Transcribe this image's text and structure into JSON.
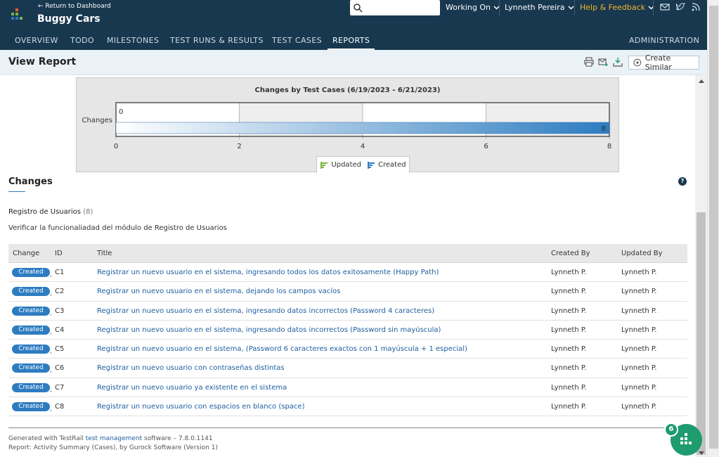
{
  "header": {
    "return_link": "← Return to Dashboard",
    "project_name": "Buggy Cars",
    "search_placeholder": "",
    "working_on": "Working On",
    "user": "Lynneth Pereira",
    "help": "Help & Feedback"
  },
  "nav": {
    "items": [
      "OVERVIEW",
      "TODO",
      "MILESTONES",
      "TEST RUNS & RESULTS",
      "TEST CASES",
      "REPORTS"
    ],
    "active": "REPORTS",
    "admin": "ADMINISTRATION"
  },
  "subheader": {
    "title": "View Report",
    "create_similar": "Create Similar"
  },
  "chart_data": {
    "type": "bar",
    "orientation": "horizontal",
    "title": "Changes by Test Cases (6/19/2023 - 6/21/2023)",
    "categories": [
      "Changes"
    ],
    "series": [
      {
        "name": "Updated",
        "values": [
          0
        ],
        "color": "#7fb241"
      },
      {
        "name": "Created",
        "values": [
          8
        ],
        "color": "#2d7cc1"
      }
    ],
    "x_ticks": [
      "0",
      "2",
      "4",
      "6",
      "8"
    ],
    "xlim": [
      0,
      8
    ],
    "data_labels": [
      "0",
      "8"
    ],
    "legend_position": "bottom"
  },
  "changes": {
    "title": "Changes",
    "group_name": "Registro de Usuarios",
    "group_count": "(8)",
    "group_desc": "Verificar la funcionaliadad del módulo de Registro de Usuarios",
    "columns": {
      "change": "Change",
      "id": "ID",
      "title": "Title",
      "created_by": "Created By",
      "updated_by": "Updated By"
    },
    "rows": [
      {
        "change": "Created",
        "id": "C1",
        "title": "Registrar un nuevo usuario en el sistema, ingresando todos los datos exitosamente (Happy Path)",
        "created_by": "Lynneth P.",
        "updated_by": "Lynneth P."
      },
      {
        "change": "Created",
        "id": "C2",
        "title": "Registrar un nuevo usuario en el sistema, dejando los campos vacíos",
        "created_by": "Lynneth P.",
        "updated_by": "Lynneth P."
      },
      {
        "change": "Created",
        "id": "C3",
        "title": "Registrar un nuevo usuario en el sistema, ingresando datos incorrectos (Password 4 caracteres)",
        "created_by": "Lynneth P.",
        "updated_by": "Lynneth P."
      },
      {
        "change": "Created",
        "id": "C4",
        "title": "Registrar un nuevo usuario en el sistema, ingresando datos incorrectos (Password sin mayúscula)",
        "created_by": "Lynneth P.",
        "updated_by": "Lynneth P."
      },
      {
        "change": "Created",
        "id": "C5",
        "title": "Registrar un nuevo usuario en el sistema, (Password 6 caracteres exactos con 1 mayúscula + 1 especial)",
        "created_by": "Lynneth P.",
        "updated_by": "Lynneth P."
      },
      {
        "change": "Created",
        "id": "C6",
        "title": "Registrar un nuevo usuario con contraseñas distintas",
        "created_by": "Lynneth P.",
        "updated_by": "Lynneth P."
      },
      {
        "change": "Created",
        "id": "C7",
        "title": "Registrar un nuevo usuario ya existente en el sistema",
        "created_by": "Lynneth P.",
        "updated_by": "Lynneth P."
      },
      {
        "change": "Created",
        "id": "C8",
        "title": "Registrar un nuevo usuario con espacios en blanco (space)",
        "created_by": "Lynneth P.",
        "updated_by": "Lynneth P."
      }
    ]
  },
  "footer": {
    "generated_prefix": "Generated with TestRail ",
    "generated_link": "test management",
    "generated_suffix": " software – 7.8.0.1141",
    "report_info": "Report: Activity Summary (Cases), by Gurock Software (Version 1)"
  },
  "fab": {
    "badge": "6"
  },
  "colors": {
    "header_bg": "#18384f",
    "accent": "#2d7cc1",
    "help": "#f2b132",
    "fab": "#1e9b6f"
  }
}
